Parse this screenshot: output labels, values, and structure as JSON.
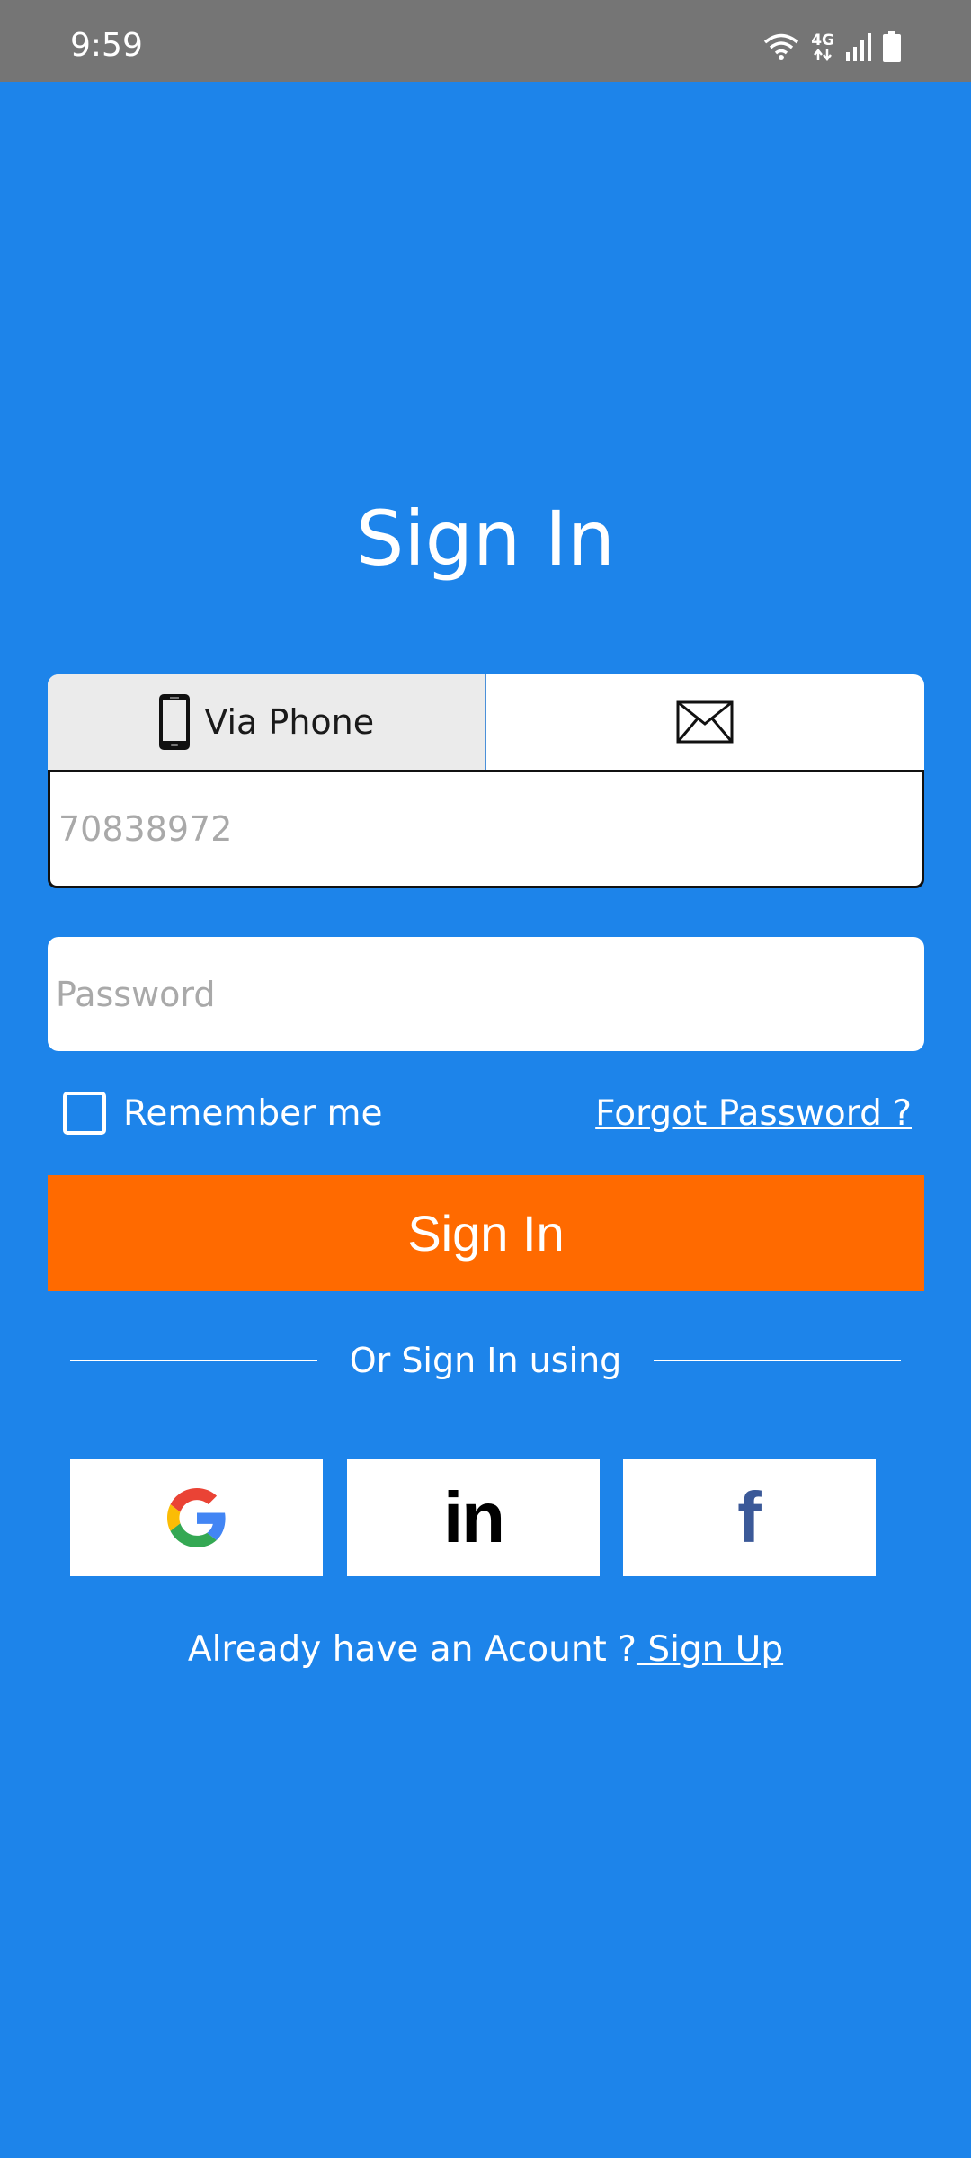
{
  "status_bar": {
    "time": "9:59",
    "network": "4G",
    "icons": [
      "wifi-icon",
      "network-4g-icon",
      "signal-icon",
      "battery-icon"
    ]
  },
  "title": "Sign In",
  "tabs": {
    "phone_label": "Via Phone",
    "phone_icon": "phone-icon",
    "email_icon": "envelope-icon",
    "selected": "phone"
  },
  "phone_field": {
    "placeholder": "70838972"
  },
  "password_field": {
    "placeholder": "Password"
  },
  "remember_me": {
    "label": "Remember me",
    "checked": false
  },
  "forgot_password": "Forgot Password ?",
  "sign_in_button": "Sign In",
  "divider_text": "Or Sign In using",
  "social": [
    {
      "name": "Google",
      "icon": "google-icon"
    },
    {
      "name": "LinkedIn",
      "icon": "linkedin-icon",
      "glyph": "in"
    },
    {
      "name": "Facebook",
      "icon": "facebook-icon",
      "glyph": "f"
    }
  ],
  "signup": {
    "prompt": "Already have an Acount ?",
    "link": " Sign Up"
  },
  "colors": {
    "background": "#1d84ea",
    "status_bar": "#757575",
    "primary_button": "#ff6a00",
    "facebook": "#3b5998"
  }
}
